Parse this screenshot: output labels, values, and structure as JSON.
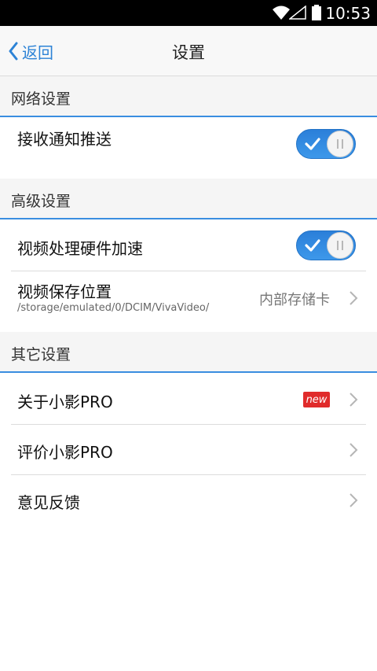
{
  "status_bar": {
    "time": "10:53"
  },
  "header": {
    "back_label": "返回",
    "title": "设置"
  },
  "sections": {
    "network": {
      "title": "网络设置",
      "push": {
        "label": "接收通知推送",
        "enabled": true
      }
    },
    "advanced": {
      "title": "高级设置",
      "hw_accel": {
        "label": "视频处理硬件加速",
        "enabled": true
      },
      "save_location": {
        "label": "视频保存位置",
        "path": "/storage/emulated/0/DCIM/VivaVideo/",
        "value": "内部存储卡"
      }
    },
    "other": {
      "title": "其它设置",
      "about": {
        "label": "关于小影PRO",
        "badge": "new"
      },
      "rate": {
        "label": "评价小影PRO"
      },
      "feedback": {
        "label": "意见反馈"
      }
    }
  },
  "colors": {
    "accent": "#2d83d6",
    "toggle_on": "#2b7fd9",
    "badge": "#e02b2b"
  }
}
